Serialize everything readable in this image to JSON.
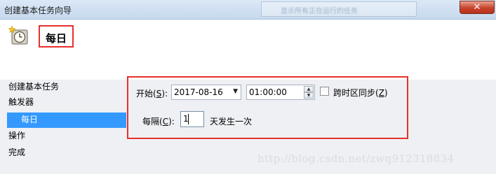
{
  "window": {
    "title": "创建基本任务向导",
    "close_symbol": "✕",
    "background_window_text": "显示所有正在运行的任务"
  },
  "header": {
    "page_title": "每日",
    "icon": "clock-icon"
  },
  "sidebar": {
    "items": [
      {
        "label": "创建基本任务",
        "selected": false
      },
      {
        "label": "触发器",
        "selected": false
      },
      {
        "label": "每日",
        "selected": true
      },
      {
        "label": "操作",
        "selected": false
      },
      {
        "label": "完成",
        "selected": false
      }
    ]
  },
  "form": {
    "start_label": "开始(",
    "start_mnemonic": "S",
    "start_label_end": "):",
    "start_date": "2017-08-16",
    "start_time": "01:00:00",
    "sync_label": "跨时区同步(",
    "sync_mnemonic": "Z",
    "sync_label_end": ")",
    "sync_checked": false,
    "interval_label": "每隔(",
    "interval_mnemonic": "C",
    "interval_label_end": "):",
    "interval_value": "1",
    "interval_suffix": "天发生一次"
  },
  "watermark": "http://blog.csdn.net/zwq912318834",
  "colors": {
    "highlight_border": "#e8302b",
    "selection": "#3399ff",
    "panel_bg": "#eef0f4"
  }
}
